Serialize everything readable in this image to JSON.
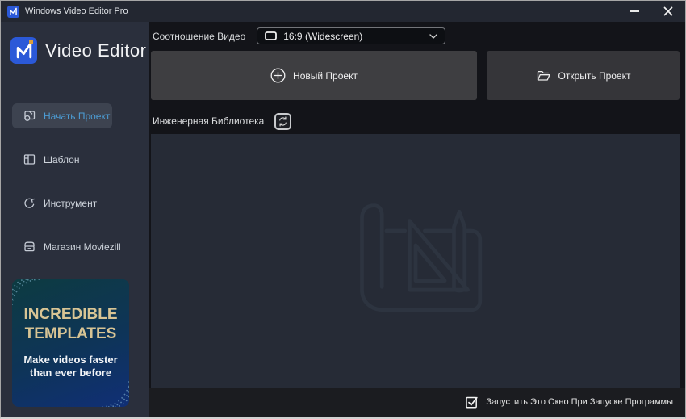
{
  "titlebar": {
    "title": "Windows Video Editor Pro"
  },
  "brand": {
    "logo_letter": "M",
    "name": "Video Editor"
  },
  "sidebar": {
    "items": [
      {
        "label": "Начать Проект",
        "active": true
      },
      {
        "label": "Шаблон",
        "active": false
      },
      {
        "label": "Инструмент",
        "active": false
      },
      {
        "label": "Магазин Moviezill",
        "active": false
      }
    ],
    "promo": {
      "headline_line1": "INCREDIBLE",
      "headline_line2": "TEMPLATES",
      "sub_line1": "Make videos faster",
      "sub_line2": "than ever before"
    }
  },
  "main": {
    "aspect_label": "Соотношение Видео",
    "aspect_value": "16:9 (Widescreen)",
    "new_project_label": "Новый Проект",
    "open_project_label": "Открыть Проект",
    "library_title": "Инженерная Библиотека",
    "startup_checkbox": {
      "label": "Запустить Это Окно При Запуске Программы",
      "checked": true
    }
  },
  "colors": {
    "accent_blue": "#4c9cd4",
    "logo_blue": "#2b59d8",
    "logo_orange": "#dba03c",
    "banner_gold": "#d8c494",
    "sidebar_bg": "#2a2f3c",
    "panel_bg": "#262b36"
  }
}
